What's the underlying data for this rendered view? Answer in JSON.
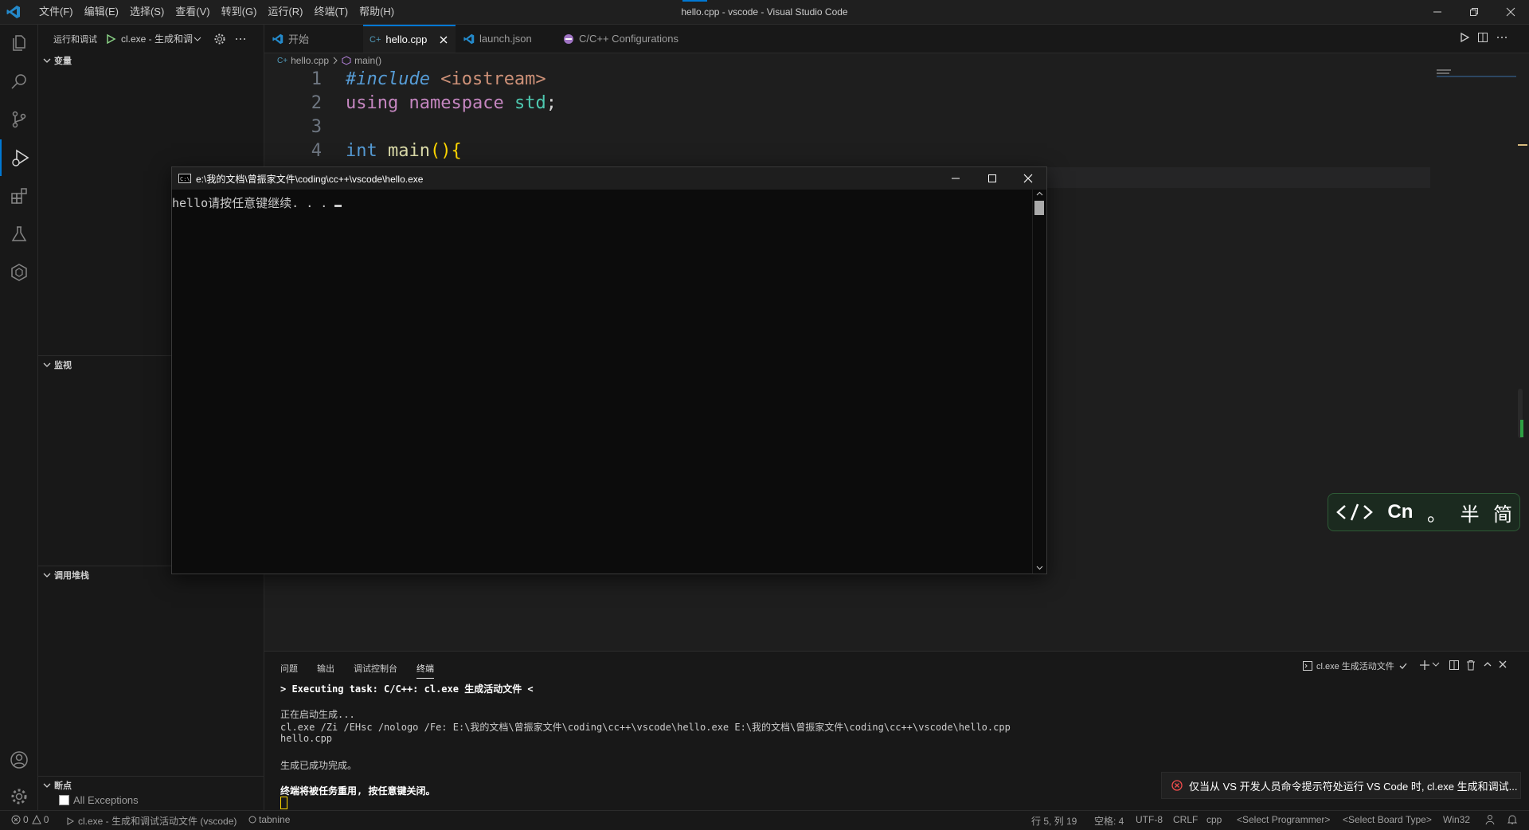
{
  "window": {
    "title": "hello.cpp - vscode - Visual Studio Code",
    "menu": [
      "文件(F)",
      "编辑(E)",
      "选择(S)",
      "查看(V)",
      "转到(G)",
      "运行(R)",
      "终端(T)",
      "帮助(H)"
    ]
  },
  "sidebar": {
    "title": "运行和调试",
    "config": "cl.exe - 生成和调",
    "sections": {
      "variables": "变量",
      "watch": "监视",
      "callstack": "调用堆栈",
      "breakpoints": "断点"
    },
    "breakpoint_item": "All Exceptions"
  },
  "tabs": [
    {
      "label": "开始"
    },
    {
      "label": "hello.cpp"
    },
    {
      "label": "launch.json"
    },
    {
      "label": "C/C++ Configurations"
    }
  ],
  "breadcrumb": {
    "file": "hello.cpp",
    "symbol": "main()"
  },
  "code": {
    "line1": {
      "num": "1",
      "directive": "#include",
      "header": "<iostream>"
    },
    "line2": {
      "num": "2",
      "kw1": "using",
      "kw2": "namespace",
      "ns": "std",
      "semi": ";"
    },
    "line3": {
      "num": "3"
    },
    "line4": {
      "num": "4",
      "type": "int",
      "fn": "main",
      "paren": "()",
      "brace": "{"
    }
  },
  "console": {
    "title": "e:\\我的文档\\曾振家文件\\coding\\cc++\\vscode\\hello.exe",
    "output": "hello请按任意键继续. . . "
  },
  "panel": {
    "tabs": [
      "问题",
      "输出",
      "调试控制台",
      "终端"
    ],
    "task_label": "cl.exe 生成活动文件",
    "lines": {
      "l1": "> Executing task: C/C++: cl.exe 生成活动文件 <",
      "l2": "正在启动生成...",
      "l3": "cl.exe /Zi /EHsc /nologo /Fe: E:\\我的文档\\曾振家文件\\coding\\cc++\\vscode\\hello.exe E:\\我的文档\\曾振家文件\\coding\\cc++\\vscode\\hello.cpp",
      "l4": "hello.cpp",
      "l5": "生成已成功完成。",
      "l6": "终端将被任务重用, 按任意键关闭。"
    }
  },
  "notification": {
    "text": "仅当从 VS 开发人员命令提示符处运行 VS Code 时, cl.exe 生成和调试..."
  },
  "ime": {
    "cn": "Cn",
    "dot": "。",
    "half": "半",
    "simp": "简"
  },
  "status": {
    "errors": "0",
    "warnings": "0",
    "debug": "cl.exe - 生成和调试活动文件 (vscode)",
    "tabnine": "tabnine",
    "position": "行 5, 列 19",
    "spaces": "空格: 4",
    "encoding": "UTF-8",
    "eol": "CRLF",
    "lang": "cpp",
    "programmer": "<Select Programmer>",
    "board": "<Select Board Type>",
    "platform": "Win32"
  },
  "colors": {
    "accent": "#0078d4",
    "background": "#1e1e1e",
    "error": "#f14c4c"
  }
}
